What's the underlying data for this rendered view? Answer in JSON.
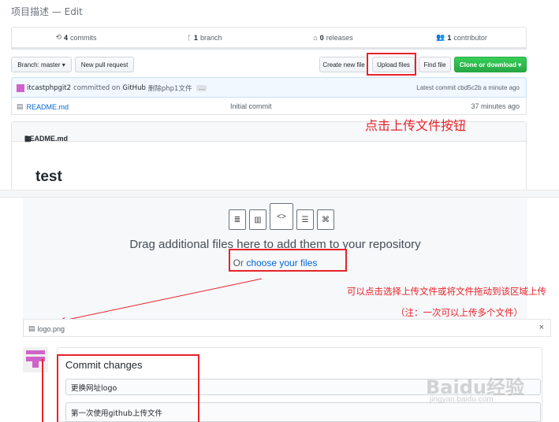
{
  "description": {
    "text": "项目描述 — Edit"
  },
  "summary": {
    "commits_icon": "history-icon",
    "commits_count": "4",
    "commits_label": "commits",
    "branch_icon": "branch-icon",
    "branch_count": "1",
    "branch_label": "branch",
    "releases_icon": "tag-icon",
    "releases_count": "0",
    "releases_label": "releases",
    "contributors_icon": "people-icon",
    "contributors_count": "1",
    "contributors_label": "contributor"
  },
  "toolbar": {
    "branch": "Branch: master ▾",
    "new_pr": "New pull request",
    "create_file": "Create new file",
    "upload_files": "Upload files",
    "find_file": "Find file",
    "clone": "Clone or download ▾"
  },
  "commit_bar": {
    "author": "itcastphpgit2",
    "committed_on": "committed on",
    "platform": "GitHub",
    "message": "删除php1文件",
    "ellipsis": "…",
    "latest": "Latest commit cbd5c2b a minute ago"
  },
  "files": [
    {
      "name": "README.md",
      "message": "Initial commit",
      "age": "37 minutes ago"
    }
  ],
  "readme": {
    "header": "README.md",
    "title": "test"
  },
  "annotations": {
    "upload_hint": "点击上传文件按钮",
    "drag_hint": "可以点击选择上传文件或将文件拖动到该区域上传",
    "multi_hint": "（注：一次可以上传多个文件）"
  },
  "dropzone": {
    "title": "Drag additional files here to add them to your repository",
    "or": "Or",
    "choose": "choose your files"
  },
  "uploaded": {
    "name": "logo.png",
    "remove": "×"
  },
  "commit_changes": {
    "title": "Commit changes",
    "summary_value": "更换网址logo",
    "description_value": "第一次使用github上传文件"
  },
  "watermark": {
    "main": "Baidu经验",
    "sub": "jingyan.baidu.com"
  },
  "colors": {
    "accent_red": "#e8232a",
    "link_blue": "#0366d6",
    "green": "#28a745"
  }
}
